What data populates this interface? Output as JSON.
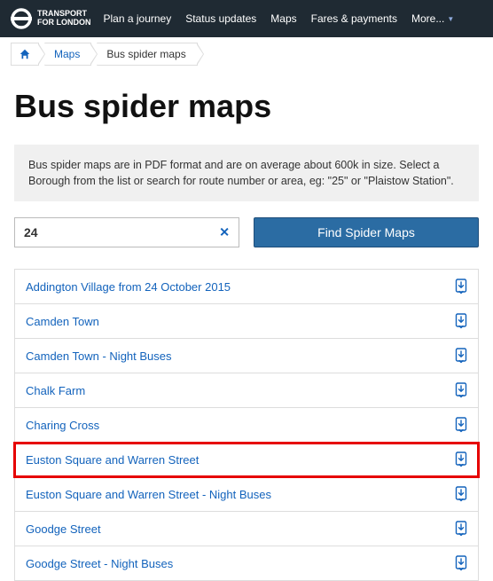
{
  "header": {
    "brand_line1": "TRANSPORT",
    "brand_line2": "FOR LONDON",
    "nav": [
      "Plan a journey",
      "Status updates",
      "Maps",
      "Fares & payments"
    ],
    "more_label": "More..."
  },
  "breadcrumb": {
    "maps": "Maps",
    "current": "Bus spider maps"
  },
  "page": {
    "title": "Bus spider maps",
    "intro": "Bus spider maps are in PDF format and are on average about 600k in size. Select a Borough from the list or search for route number or area, eg: \"25\" or \"Plaistow Station\"."
  },
  "search": {
    "value": "24",
    "button": "Find Spider Maps"
  },
  "results": [
    {
      "label": "Addington Village from 24 October 2015",
      "hl": false
    },
    {
      "label": "Camden Town",
      "hl": false
    },
    {
      "label": "Camden Town - Night Buses",
      "hl": false
    },
    {
      "label": "Chalk Farm",
      "hl": false
    },
    {
      "label": "Charing Cross",
      "hl": false
    },
    {
      "label": "Euston Square and Warren Street",
      "hl": true
    },
    {
      "label": "Euston Square and Warren Street - Night Buses",
      "hl": false
    },
    {
      "label": "Goodge Street",
      "hl": false
    },
    {
      "label": "Goodge Street - Night Buses",
      "hl": false
    }
  ]
}
